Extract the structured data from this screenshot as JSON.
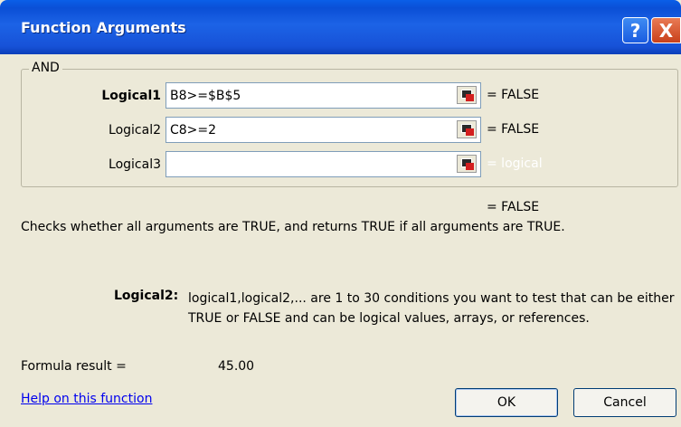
{
  "window": {
    "title": "Function Arguments",
    "help_glyph": "?",
    "close_glyph": "X"
  },
  "group": {
    "label": "AND"
  },
  "args": [
    {
      "label": "Logical1",
      "value": "B8>=$B$5",
      "result": "= FALSE"
    },
    {
      "label": "Logical2",
      "value": "C8>=2",
      "result": "= FALSE"
    },
    {
      "label": "Logical3",
      "value": "",
      "result": "= logical"
    }
  ],
  "overall_result": "= FALSE",
  "description": "Checks whether all arguments are TRUE, and returns TRUE if all arguments are TRUE.",
  "arg_help": {
    "name": "Logical2:",
    "text": "logical1,logical2,... are 1 to 30 conditions you want to test that can be either TRUE or FALSE and can be logical values, arrays, or references."
  },
  "formula": {
    "label": "Formula result =",
    "value": "45.00"
  },
  "help_link": "Help on this function",
  "buttons": {
    "ok": "OK",
    "cancel": "Cancel"
  },
  "icons": {
    "help": "help-icon",
    "close": "close-icon",
    "collapse": "collapse-dialog-icon"
  }
}
